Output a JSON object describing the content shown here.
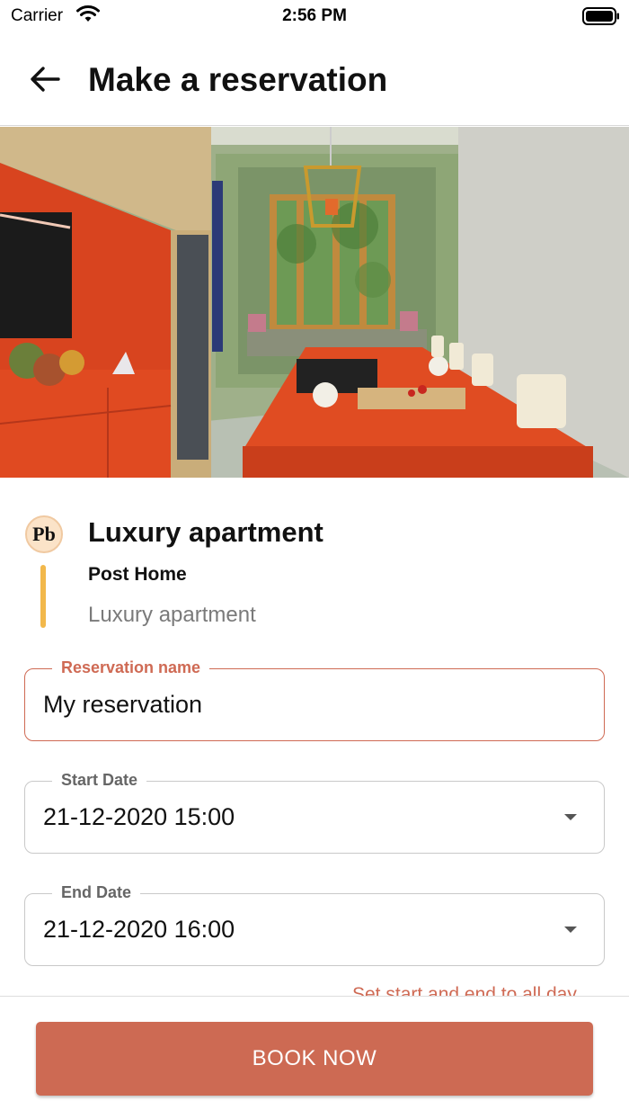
{
  "status_bar": {
    "carrier": "Carrier",
    "time": "2:56 PM"
  },
  "header": {
    "title": "Make a reservation",
    "back_icon": "arrow-left-icon"
  },
  "listing": {
    "title": "Luxury apartment",
    "owner": "Post Home",
    "subtitle": "Luxury apartment",
    "logo_text": "Pb"
  },
  "form": {
    "reservation_name": {
      "label": "Reservation name",
      "value": "My reservation"
    },
    "start_date": {
      "label": "Start Date",
      "value": "21-12-2020 15:00"
    },
    "end_date": {
      "label": "End Date",
      "value": "21-12-2020 16:00"
    },
    "helper_text": "Set start and end to all day"
  },
  "actions": {
    "book_label": "BOOK NOW"
  },
  "colors": {
    "accent": "#cd6a53",
    "logo_bar": "#f2b84b"
  }
}
